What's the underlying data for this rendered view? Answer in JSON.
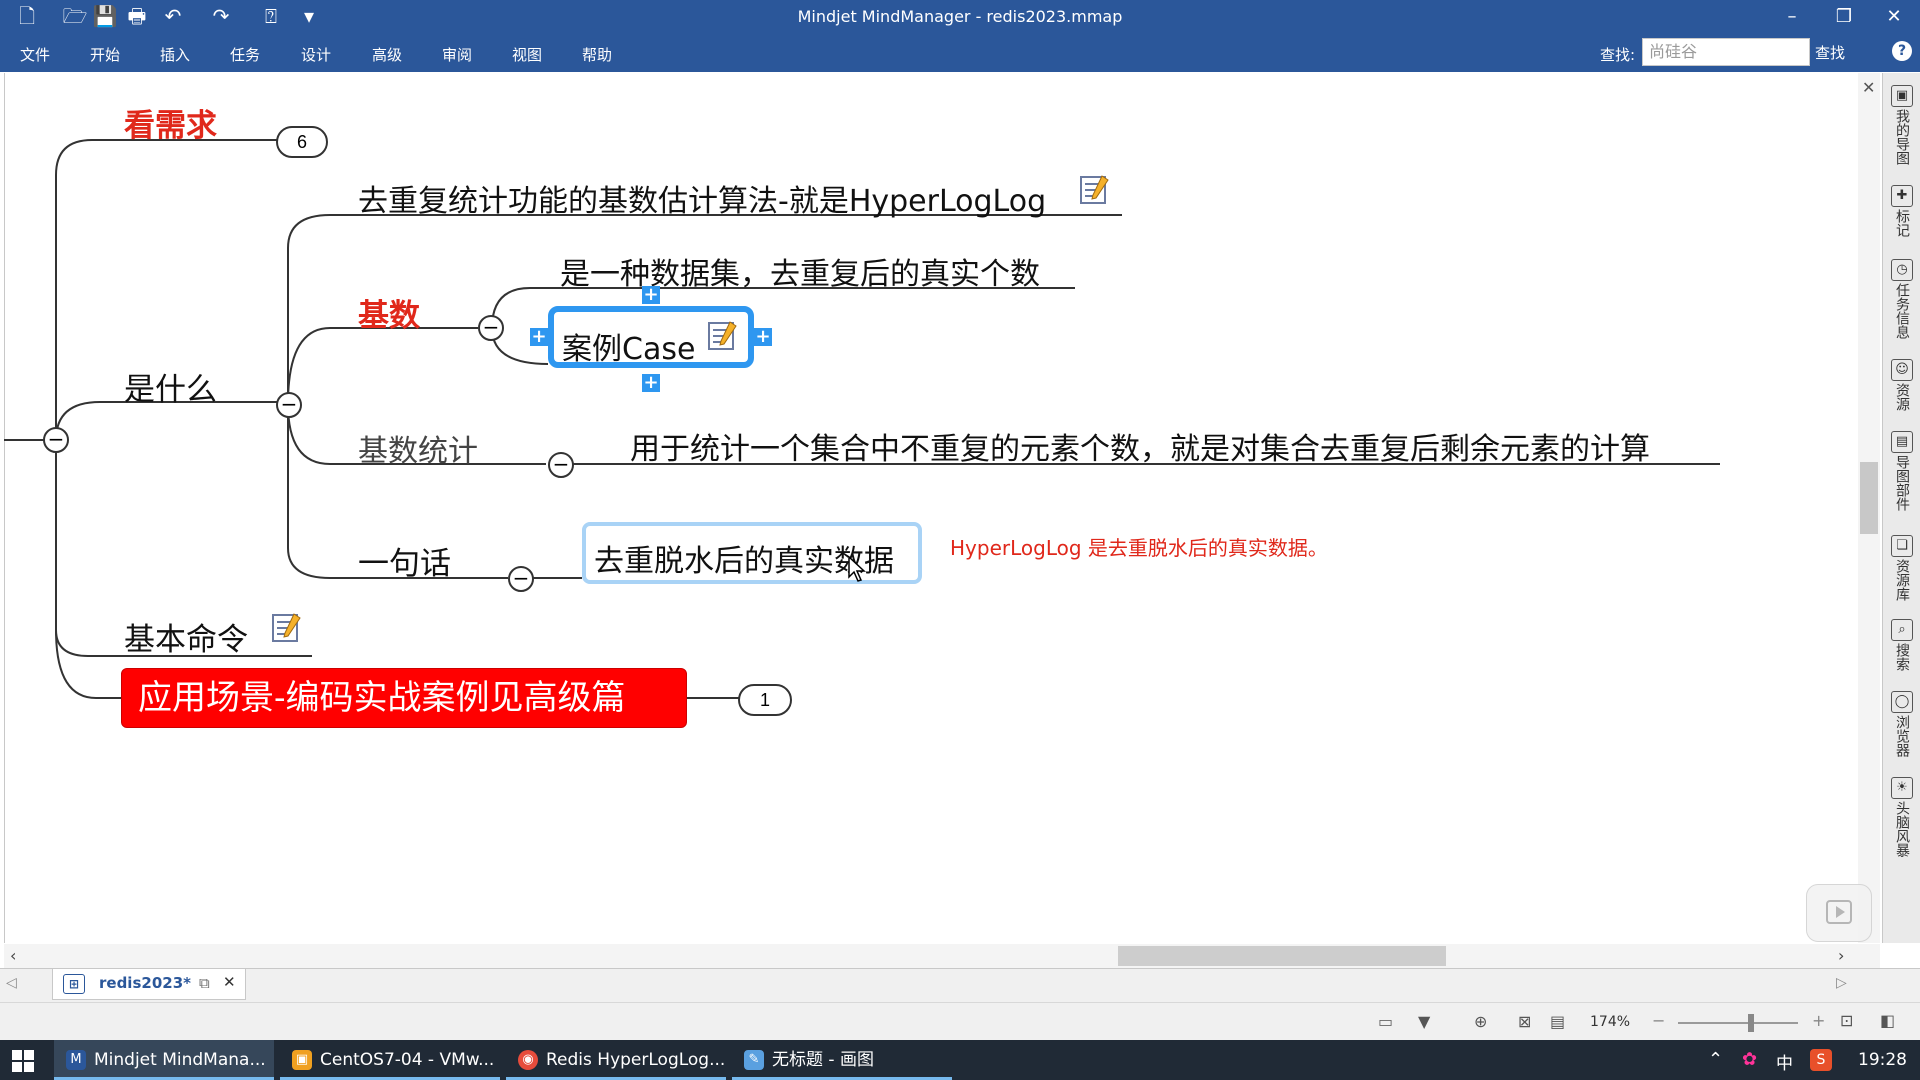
{
  "window": {
    "title": "Mindjet MindManager - redis2023.mmap"
  },
  "ribbon": {
    "tabs": [
      "文件",
      "开始",
      "插入",
      "任务",
      "设计",
      "高级",
      "审阅",
      "视图",
      "帮助"
    ],
    "find_label": "查找:",
    "find_value": "尚硅谷",
    "find_button": "查找",
    "help": "?"
  },
  "map": {
    "root_badge": "6",
    "topics": {
      "kan_xuqiu": "看需求",
      "shi_shenme": "是什么",
      "hll_def": "去重复统计功能的基数估计算法-就是HyperLogLog",
      "jishu": "基数",
      "jishu_def": "是一种数据集，去重复后的真实个数",
      "case": "案例Case",
      "jishu_tongji": "基数统计",
      "tongji_def": "用于统计一个集合中不重复的元素个数，就是对集合去重复后剩余元素的计算",
      "yijuhua": "一句话",
      "yijuhua_def": "去重脱水后的真实数据",
      "jiben_mingling": "基本命令",
      "yingyong": "应用场景-编码实战案例见高级篇",
      "yingyong_badge": "1"
    },
    "annotation": "HyperLogLog 是去重脱水后的真实数据。",
    "colors": {
      "red": "#e0281b",
      "selection": "#2e97f0",
      "banner": "#ff0000"
    }
  },
  "right_panel": {
    "items": [
      "我的导图",
      "标记",
      "任务信息",
      "资源",
      "导图部件",
      "资源库",
      "搜索",
      "浏览器",
      "头脑风暴"
    ]
  },
  "doc_tab": {
    "label": "redis2023*"
  },
  "status": {
    "zoom": "174%"
  },
  "taskbar": {
    "items": [
      "Mindjet MindMana...",
      "CentOS7-04 - VMw...",
      "Redis HyperLogLog...",
      "无标题 - 画图"
    ],
    "ime": "中",
    "clock": "19:28"
  }
}
